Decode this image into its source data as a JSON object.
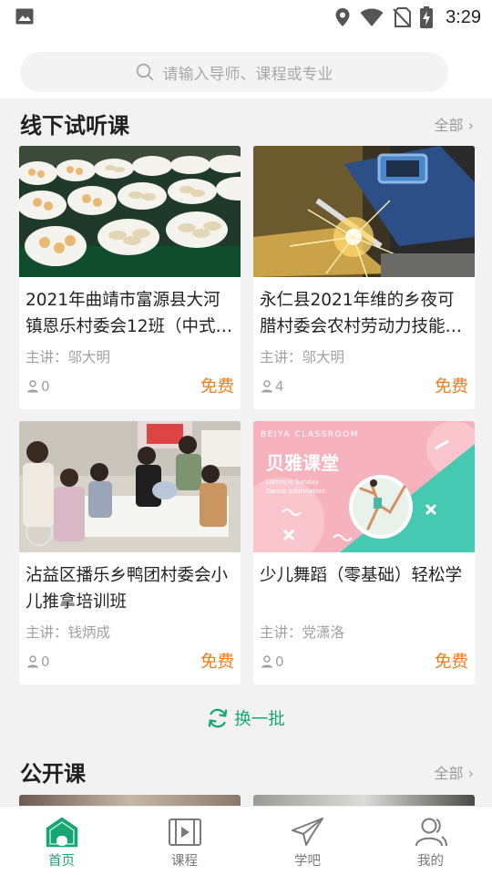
{
  "status_bar": {
    "time": "3:29"
  },
  "search": {
    "placeholder": "请输入导师、课程或专业"
  },
  "offline_section": {
    "title": "线下试听课",
    "more_label": "全部 ›",
    "courses": [
      {
        "title": "2021年曲靖市富源县大河镇恩乐村委会12班（中式…",
        "teacher": "主讲：邬大明",
        "learners": "0",
        "price": "免费",
        "thumb_icon": "dumplings-photo"
      },
      {
        "title": "永仁县2021年维的乡夜可腊村委会农村劳动力技能…",
        "teacher": "主讲：邬大明",
        "learners": "4",
        "price": "免费",
        "thumb_icon": "welding-photo"
      },
      {
        "title": "沾益区播乐乡鸭团村委会小儿推拿培训班",
        "teacher": "主讲：钱炳成",
        "learners": "0",
        "price": "免费",
        "thumb_icon": "classroom-photo"
      },
      {
        "title": "少儿舞蹈（零基础）轻松学",
        "teacher": "主讲：党潇洛",
        "learners": "0",
        "price": "免费",
        "thumb_icon": "dance-poster"
      }
    ]
  },
  "dance_poster": {
    "brand_small": "BEIYA CLASSROOM",
    "brand_big": "贝雅课堂",
    "tag_line1": "Lorem is Sunday",
    "tag_line2": "Dance information"
  },
  "refresh": {
    "label": "换一批"
  },
  "public_section": {
    "title": "公开课",
    "more_label": "全部 ›"
  },
  "tabbar": {
    "tabs": [
      {
        "label": "首页",
        "icon": "home-icon",
        "active": true
      },
      {
        "label": "课程",
        "icon": "video-icon",
        "active": false
      },
      {
        "label": "学吧",
        "icon": "paper-plane-icon",
        "active": false
      },
      {
        "label": "我的",
        "icon": "user-icon",
        "active": false
      }
    ]
  },
  "colors": {
    "accent": "#17a673",
    "price": "#ef7d1a",
    "background": "#f2f2f2"
  }
}
